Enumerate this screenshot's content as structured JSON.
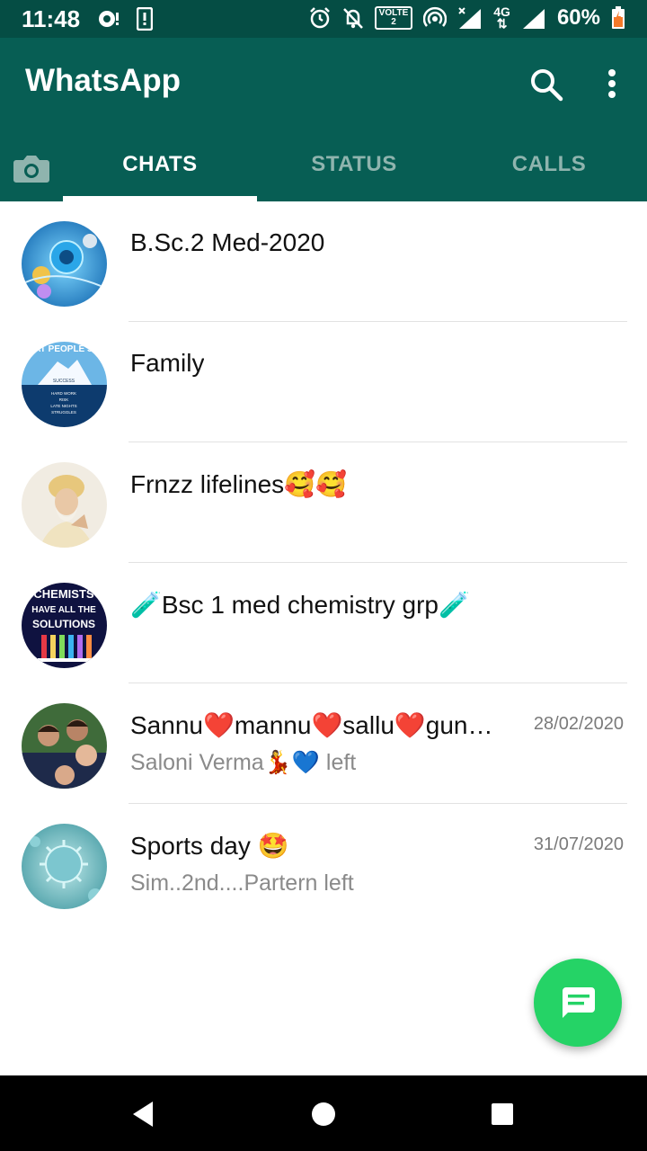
{
  "status_bar": {
    "time": "11:48",
    "network_volte": "VOLTE",
    "network_volte_sub": "2",
    "network_4g": "4G",
    "battery_text": "60%"
  },
  "app": {
    "title": "WhatsApp",
    "accent_color": "#075e54",
    "fab_color": "#25d366"
  },
  "tabs": [
    {
      "label": "CHATS",
      "selected": true
    },
    {
      "label": "STATUS",
      "selected": false
    },
    {
      "label": "CALLS",
      "selected": false
    }
  ],
  "chats": [
    {
      "name": "B.Sc.2 Med-2020",
      "date": "",
      "preview": ""
    },
    {
      "name": "Family",
      "date": "",
      "preview": ""
    },
    {
      "name": "Frnzz lifelines🥰🥰",
      "date": "",
      "preview": ""
    },
    {
      "name": "🧪Bsc 1 med chemistry grp🧪",
      "date": "",
      "preview": ""
    },
    {
      "name": "Sannu❤️mannu❤️sallu❤️gun…",
      "date": "28/02/2020",
      "preview": "Saloni Verma💃💙 left"
    },
    {
      "name": "Sports day 🤩",
      "date": "31/07/2020",
      "preview": "Sim..2nd....Partern left"
    }
  ],
  "avatar_texts": {
    "family_top": "AT PEOPLE S",
    "family_success": "SUCCESS",
    "family_lines": [
      "HARD WORK",
      "RISK",
      "LATE NIGHTS",
      "STRUGGLES"
    ],
    "chem_line1": "CHEMISTS",
    "chem_line2": "HAVE ALL THE",
    "chem_line3": "SOLUTIONS"
  }
}
